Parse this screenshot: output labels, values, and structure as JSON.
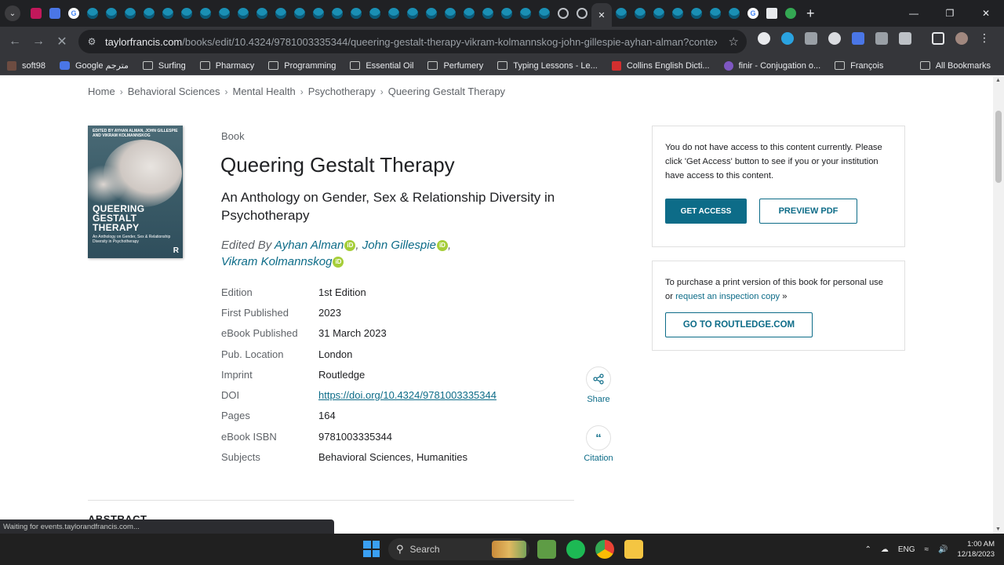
{
  "browser": {
    "url_host": "taylorfrancis.com",
    "url_path": "/books/edit/10.4324/9781003335344/queering-gestalt-therapy-vikram-kolmannskog-john-gillespie-ayhan-alman?context=ubx&refId=...",
    "bookmarks": [
      "soft98",
      "Google مترجم",
      "Surfing",
      "Pharmacy",
      "Programming",
      "Essential Oil",
      "Perfumery",
      "Typing Lessons - Le...",
      "Collins English Dicti...",
      "finir - Conjugation o...",
      "François"
    ],
    "all_bookmarks": "All Bookmarks",
    "status": "Waiting for events.taylorandfrancis.com..."
  },
  "breadcrumb": [
    "Home",
    "Behavioral Sciences",
    "Mental Health",
    "Psychotherapy",
    "Queering Gestalt Therapy"
  ],
  "book": {
    "type": "Book",
    "title": "Queering Gestalt Therapy",
    "subtitle": "An Anthology on Gender, Sex & Relationship Diversity in Psychotherapy",
    "edited_by": "Edited By",
    "editors": [
      "Ayhan Alman",
      "John Gillespie",
      "Vikram Kolmannskog"
    ],
    "cover": {
      "editors_line": "Edited by Ayhan Alman, John Gillespie and Vikram Kolmannskog",
      "title": "QUEERING GESTALT THERAPY",
      "subtitle": "An Anthology on Gender, Sex & Relationship Diversity in Psychotherapy",
      "publisher_mark": "R"
    },
    "details": [
      {
        "label": "Edition",
        "value": "1st Edition"
      },
      {
        "label": "First Published",
        "value": "2023"
      },
      {
        "label": "eBook Published",
        "value": "31 March 2023"
      },
      {
        "label": "Pub. Location",
        "value": "London"
      },
      {
        "label": "Imprint",
        "value": "Routledge"
      },
      {
        "label": "DOI",
        "value": "https://doi.org/10.4324/9781003335344"
      },
      {
        "label": "Pages",
        "value": "164"
      },
      {
        "label": "eBook ISBN",
        "value": "9781003335344"
      },
      {
        "label": "Subjects",
        "value": "Behavioral Sciences, Humanities"
      }
    ]
  },
  "actions": {
    "share": "Share",
    "citation": "Citation"
  },
  "abstract_heading": "ABSTRACT",
  "access_panel": {
    "message": "You do not have access to this content currently. Please click 'Get Access' button to see if you or your institution have access to this content.",
    "get_access": "GET ACCESS",
    "preview_pdf": "PREVIEW PDF"
  },
  "purchase_panel": {
    "message_prefix": "To purchase a print version of this book for personal use or",
    "link": "request an inspection copy",
    "button": "GO TO ROUTLEDGE.COM"
  },
  "taskbar": {
    "search_placeholder": "Search",
    "language": "ENG",
    "time": "1:00 AM",
    "date": "12/18/2023"
  },
  "colors": {
    "accent": "#0d6c88",
    "orcid": "#a6ce39",
    "chrome_dark": "#202124"
  }
}
